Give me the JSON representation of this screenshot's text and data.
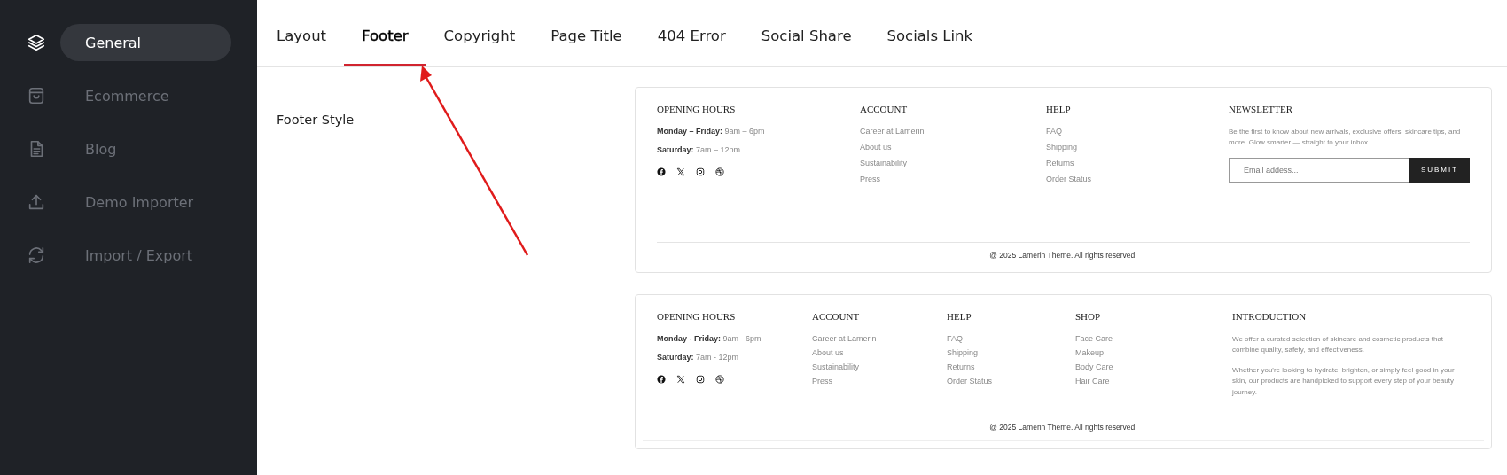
{
  "sidebar": {
    "items": [
      {
        "label": "General",
        "selected": true
      },
      {
        "label": "Ecommerce",
        "selected": false
      },
      {
        "label": "Blog",
        "selected": false
      },
      {
        "label": "Demo Importer",
        "selected": false
      },
      {
        "label": "Import / Export",
        "selected": false
      }
    ]
  },
  "tabs": [
    {
      "label": "Layout",
      "selected": false
    },
    {
      "label": "Footer",
      "selected": true
    },
    {
      "label": "Copyright",
      "selected": false
    },
    {
      "label": "Page Title",
      "selected": false
    },
    {
      "label": "404 Error",
      "selected": false
    },
    {
      "label": "Social Share",
      "selected": false
    },
    {
      "label": "Socials Link",
      "selected": false
    }
  ],
  "setting_label": "Footer Style",
  "footer_styles": [
    {
      "columns": [
        {
          "kind": "hours",
          "title": "OPENING HOURS",
          "lines": [
            "**Monday – Friday:** 9am – 6pm",
            "**Saturday:** 7am – 12pm"
          ]
        },
        {
          "kind": "links",
          "title": "ACCOUNT",
          "links": [
            "Career at Lamerin",
            "About us",
            "Sustainability",
            "Press"
          ]
        },
        {
          "kind": "links",
          "title": "HELP",
          "links": [
            "FAQ",
            "Shipping",
            "Returns",
            "Order Status"
          ]
        },
        {
          "kind": "newsletter",
          "title": "NEWSLETTER",
          "text": "Be the first to know about new arrivals, exclusive offers, skincare tips, and more. Glow smarter — straight to your inbox.",
          "placeholder": "Email addess...",
          "button": "SUBMIT"
        }
      ],
      "copyright": "@ 2025 Lamerin Theme. All rights reserved."
    },
    {
      "columns": [
        {
          "kind": "hours",
          "title": "OPENING HOURS",
          "lines": [
            "**Monday - Friday:** 9am - 6pm",
            "**Saturday:** 7am - 12pm"
          ]
        },
        {
          "kind": "links",
          "title": "ACCOUNT",
          "links": [
            "Career at Lamerin",
            "About us",
            "Sustainability",
            "Press"
          ]
        },
        {
          "kind": "links",
          "title": "HELP",
          "links": [
            "FAQ",
            "Shipping",
            "Returns",
            "Order Status"
          ]
        },
        {
          "kind": "links",
          "title": "SHOP",
          "links": [
            "Face Care",
            "Makeup",
            "Body Care",
            "Hair Care"
          ]
        },
        {
          "kind": "intro",
          "title": "INTRODUCTION",
          "paragraphs": [
            "We offer a curated selection of skincare and cosmetic products that combine quality, safety, and effectiveness.",
            "Whether you're looking to hydrate, brighten, or simply feel good in your skin, our products are handpicked to support every step of your beauty journey."
          ]
        }
      ],
      "copyright": "@ 2025 Lamerin Theme. All rights reserved."
    }
  ]
}
